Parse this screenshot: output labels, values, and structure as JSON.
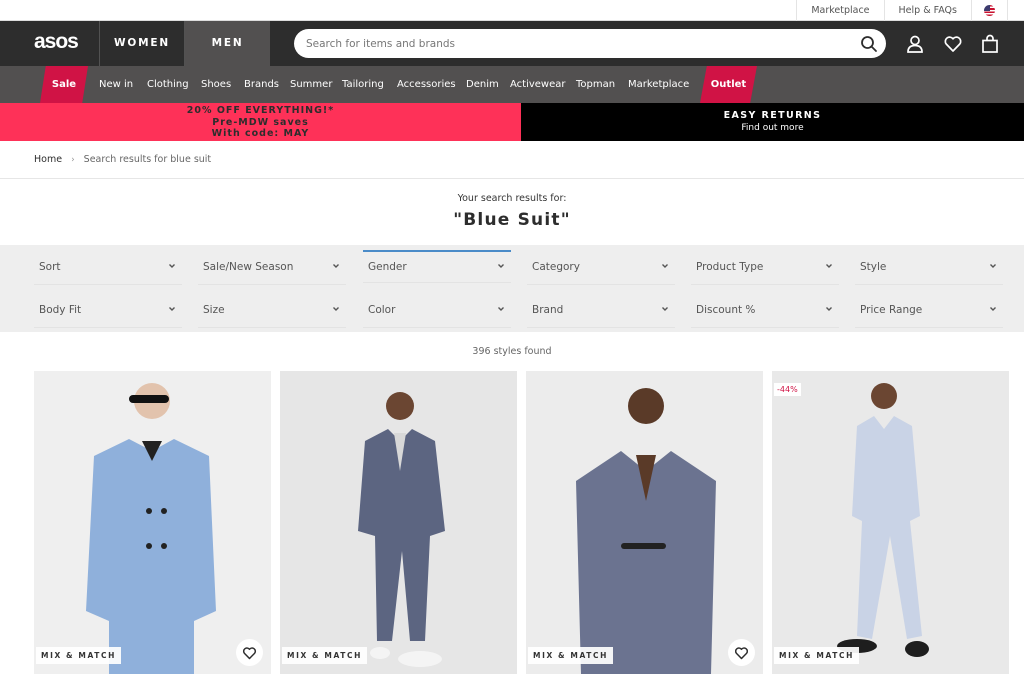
{
  "utility": {
    "links": [
      "Marketplace",
      "Help & FAQs"
    ],
    "country_icon": "us-flag-icon"
  },
  "header": {
    "logo": "asos",
    "tabs": [
      {
        "label": "WOMEN",
        "active": false
      },
      {
        "label": "MEN",
        "active": true
      }
    ],
    "search": {
      "placeholder": "Search for items and brands",
      "value": ""
    },
    "icons": [
      "search-icon",
      "account-icon",
      "heart-icon",
      "bag-icon"
    ]
  },
  "nav": {
    "items": [
      "Sale",
      "New in",
      "Clothing",
      "Shoes",
      "Brands",
      "Summer",
      "Tailoring",
      "Accessories",
      "Denim",
      "Activewear",
      "Topman",
      "Marketplace",
      "Outlet"
    ],
    "highlight_color": "#d01345"
  },
  "promo": {
    "left": {
      "line1": "20% OFF EVERYTHING!*",
      "line2": "Pre-MDW saves",
      "line3": "With code: MAY",
      "color": "#fe3158"
    },
    "right": {
      "title": "EASY RETURNS",
      "link": "Find out more"
    }
  },
  "breadcrumb": {
    "home": "Home",
    "separator": "›",
    "current": "Search results for blue suit"
  },
  "results": {
    "subtitle": "Your search results for:",
    "term": "\"Blue Suit\"",
    "count": "396 styles found"
  },
  "filters": [
    {
      "label": "Sort",
      "active": false
    },
    {
      "label": "Sale/New Season",
      "active": false
    },
    {
      "label": "Gender",
      "active": true
    },
    {
      "label": "Category",
      "active": false
    },
    {
      "label": "Product Type",
      "active": false
    },
    {
      "label": "Style",
      "active": false
    },
    {
      "label": "Body Fit",
      "active": false
    },
    {
      "label": "Size",
      "active": false
    },
    {
      "label": "Color",
      "active": false
    },
    {
      "label": "Brand",
      "active": false
    },
    {
      "label": "Discount %",
      "active": false
    },
    {
      "label": "Price Range",
      "active": false
    }
  ],
  "products": [
    {
      "badge": "MIX & MATCH",
      "discount": null,
      "wishlist": true,
      "suit_color": "#8fb0db"
    },
    {
      "badge": "MIX & MATCH",
      "discount": null,
      "wishlist": false,
      "suit_color": "#5c6581"
    },
    {
      "badge": "MIX & MATCH",
      "discount": null,
      "wishlist": true,
      "suit_color": "#6b7390"
    },
    {
      "badge": "MIX & MATCH",
      "discount": "-44%",
      "wishlist": false,
      "suit_color": "#c9d3e6"
    }
  ]
}
